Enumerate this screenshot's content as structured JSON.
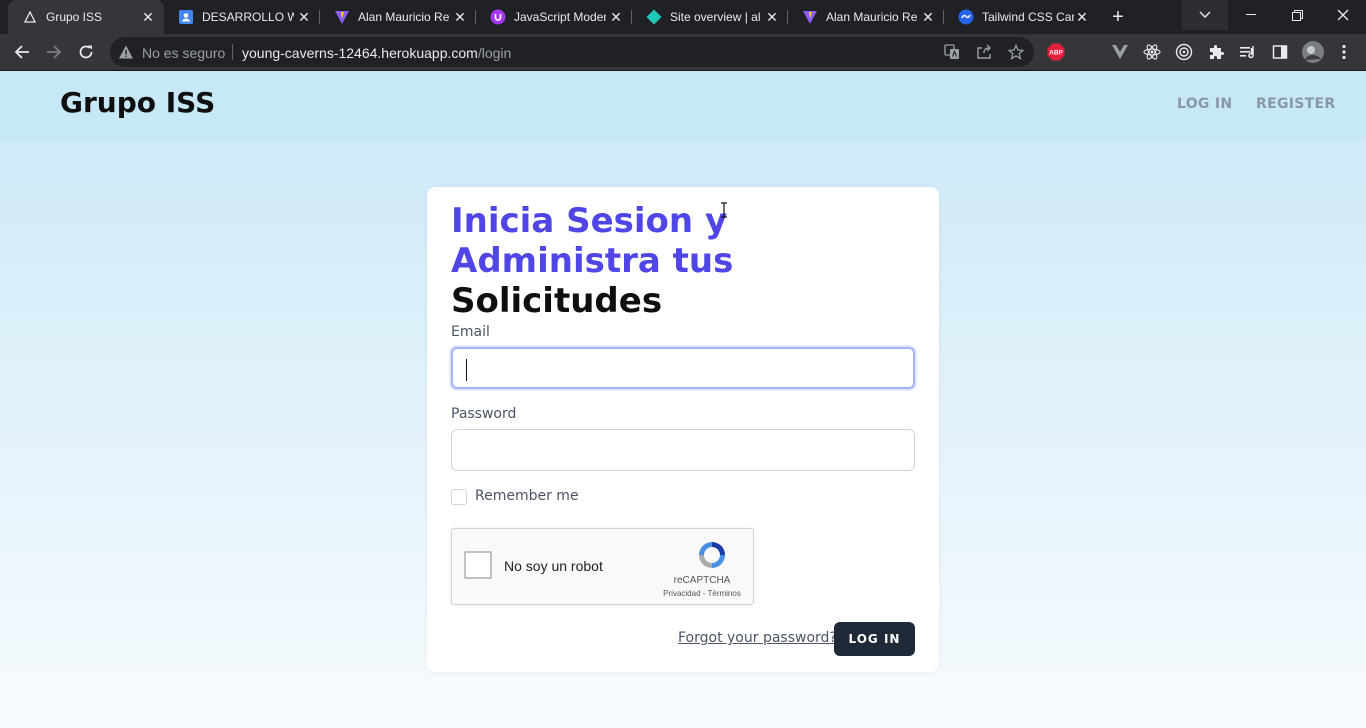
{
  "browser": {
    "tabs": [
      {
        "title": "Grupo ISS",
        "icon": "triangle-icon",
        "active": true
      },
      {
        "title": "DESARROLLO WE",
        "icon": "contacts-icon"
      },
      {
        "title": "Alan Mauricio Re",
        "icon": "vite-icon"
      },
      {
        "title": "JavaScript Moder",
        "icon": "udemy-icon"
      },
      {
        "title": "Site overview | al",
        "icon": "netlify-icon"
      },
      {
        "title": "Alan Mauricio Re",
        "icon": "vite-icon"
      },
      {
        "title": "Tailwind CSS Card",
        "icon": "tailwind-icon"
      }
    ],
    "security_label": "No es seguro",
    "url_host": "young-caverns-12464.herokuapp.com",
    "url_path": "/login",
    "adblock_label": "ABP"
  },
  "site": {
    "brand": "Grupo ISS",
    "nav": {
      "login": "LOG IN",
      "register": "REGISTER"
    }
  },
  "form": {
    "title_part1": "Inicia Sesion y Administra tus",
    "title_part2": "Solicitudes",
    "email_label": "Email",
    "email_value": "",
    "password_label": "Password",
    "password_value": "",
    "remember_label": "Remember me",
    "captcha": {
      "text": "No soy un robot",
      "brand": "reCAPTCHA",
      "terms": "Privacidad - Términos"
    },
    "forgot_label": "Forgot your password?",
    "submit_label": "LOG IN"
  },
  "colors": {
    "accent": "#4f46e5",
    "button": "#1f2937",
    "topbar": "#c6e8f7"
  }
}
